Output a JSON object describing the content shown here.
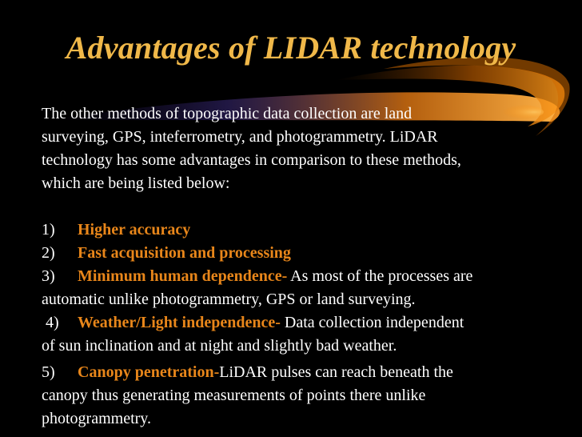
{
  "slide": {
    "title": "Advantages of LIDAR technology",
    "intro_lines": [
      "The other methods of topographic data collection are land",
      "surveying, GPS, inteferrometry, and photogrammetry.   LiDAR",
      "technology has some advantages in comparison to these methods,",
      "which are being listed below:"
    ],
    "items": [
      {
        "number": "1)",
        "heading": "Higher accuracy",
        "text": "",
        "continuation": ""
      },
      {
        "number": "2)",
        "heading": "Fast acquisition and processing",
        "text": "",
        "continuation": ""
      },
      {
        "number": "3)",
        "heading": "Minimum human dependence-",
        "text": " As most of the processes are",
        "continuation": "automatic unlike photogrammetry, GPS or land surveying."
      },
      {
        "number": "4)",
        "heading": "Weather/Light independence-",
        "text": " Data collection independent",
        "continuation": "of sun inclination and at night and slightly bad weather."
      },
      {
        "number": "5)",
        "heading": "Canopy penetration-",
        "text": "LiDAR pulses can reach  beneath the",
        "continuation": "canopy thus generating measurements of points there unlike",
        "continuation2": "photogrammetry."
      }
    ]
  },
  "colors": {
    "background": "#000000",
    "title": "#f0b849",
    "highlight": "#e8861a",
    "text": "#ffffff"
  }
}
